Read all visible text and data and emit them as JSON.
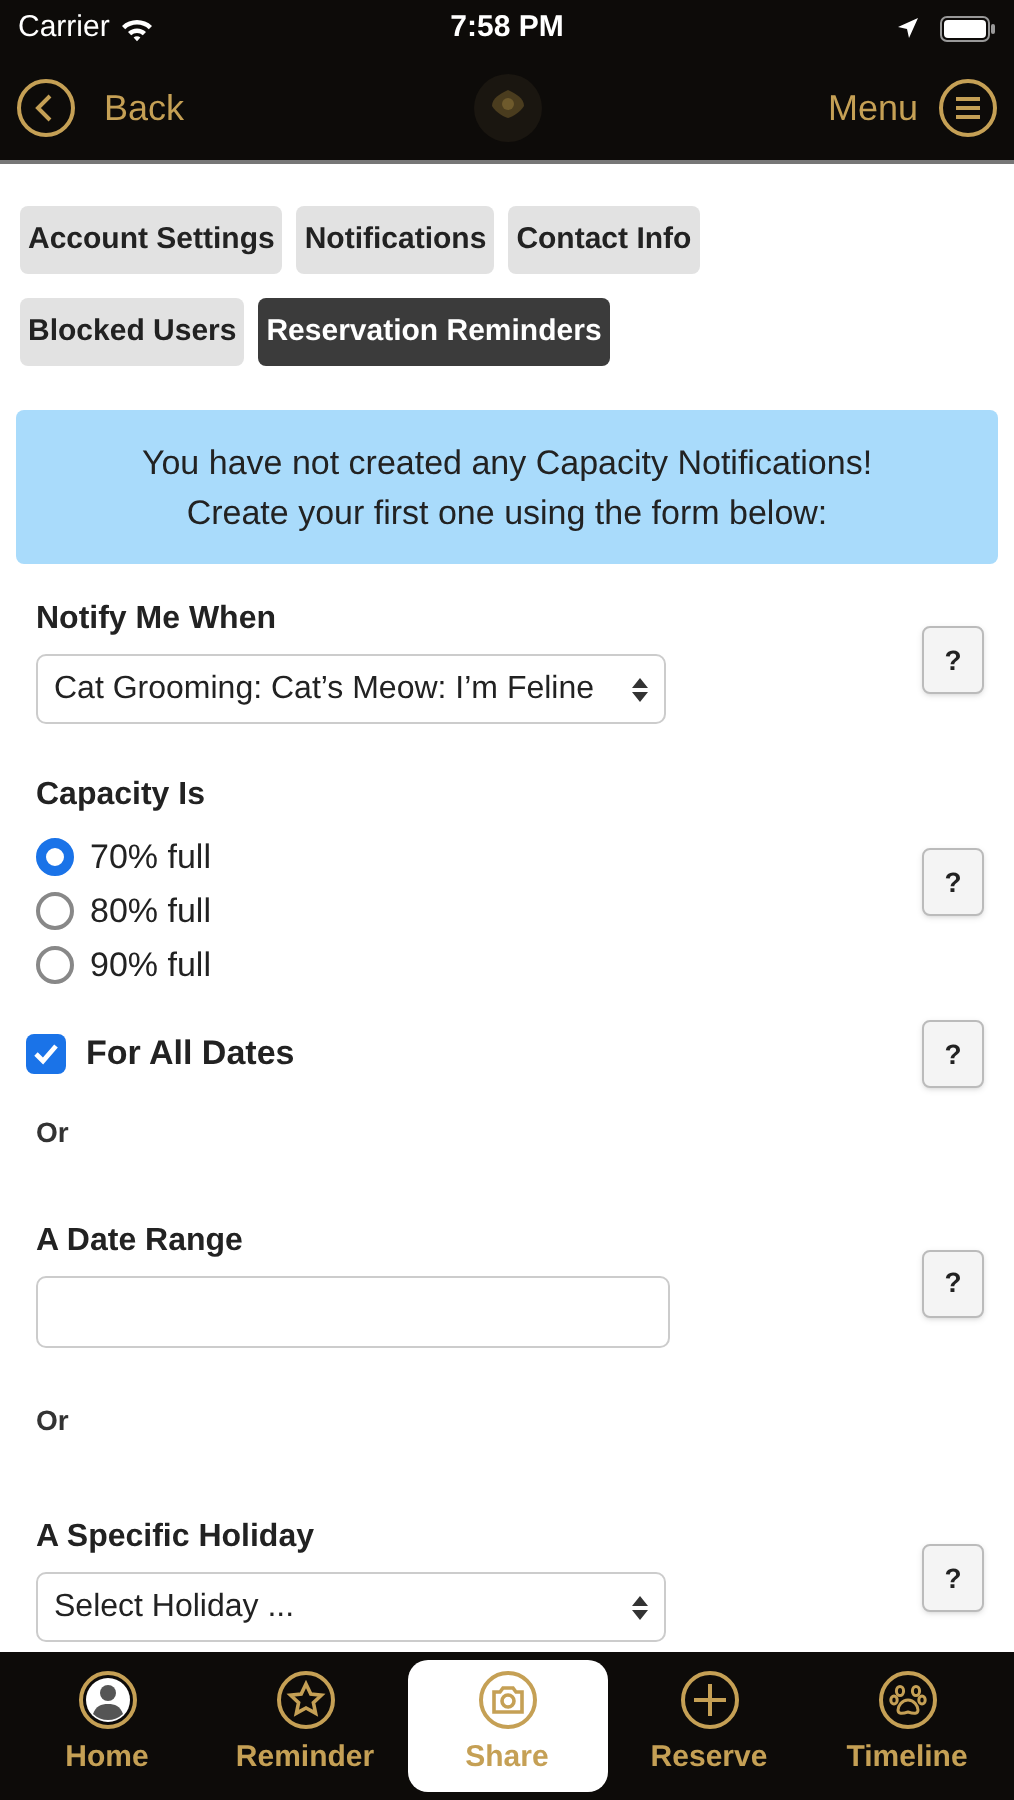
{
  "status_bar": {
    "carrier": "Carrier",
    "time": "7:58 PM"
  },
  "nav": {
    "back": "Back",
    "menu": "Menu"
  },
  "tabs": [
    {
      "label": "Account Settings",
      "selected": false
    },
    {
      "label": "Notifications",
      "selected": false
    },
    {
      "label": "Contact Info",
      "selected": false
    },
    {
      "label": "Blocked Users",
      "selected": false
    },
    {
      "label": "Reservation Reminders",
      "selected": true
    }
  ],
  "notice": "You have not created any Capacity Notifications!\nCreate your first one using the form below:",
  "sections": [
    {
      "kind": "select",
      "label": "Notify Me When",
      "value": "Cat Grooming: Cat’s Meow: I’m Feline",
      "help": "?"
    },
    {
      "kind": "radio",
      "label": "Capacity Is",
      "options": [
        {
          "label": "70% full",
          "selected": true
        },
        {
          "label": "80% full",
          "selected": false
        },
        {
          "label": "90% full",
          "selected": false
        }
      ],
      "help": "?"
    },
    {
      "kind": "checkbox",
      "label": "For All Dates",
      "checked": true,
      "help": "?"
    },
    {
      "kind": "or",
      "text": "Or"
    },
    {
      "kind": "text",
      "label": "A Date Range",
      "help": "?"
    },
    {
      "kind": "or",
      "text": "Or"
    },
    {
      "kind": "select",
      "label": "A Specific Holiday",
      "value": "Select Holiday ...",
      "help": "?"
    }
  ],
  "tab_bar": [
    {
      "label": "Home",
      "selected": false
    },
    {
      "label": "Reminder",
      "selected": false
    },
    {
      "label": "Share",
      "selected": true
    },
    {
      "label": "Reserve",
      "selected": false
    },
    {
      "label": "Timeline",
      "selected": false
    }
  ]
}
